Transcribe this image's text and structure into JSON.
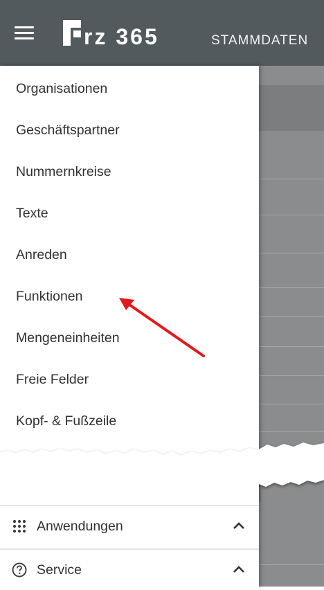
{
  "appbar": {
    "title": "STAMMDATEN",
    "logo_text": "rz 365",
    "menu_icon": "hamburger-menu-icon"
  },
  "drawer": {
    "items": [
      {
        "label": "Organisationen"
      },
      {
        "label": "Geschäftspartner"
      },
      {
        "label": "Nummernkreise"
      },
      {
        "label": "Texte"
      },
      {
        "label": "Anreden"
      },
      {
        "label": "Funktionen"
      },
      {
        "label": "Mengeneinheiten"
      },
      {
        "label": "Freie Felder"
      },
      {
        "label": "Kopf- & Fußzeile"
      }
    ],
    "sections": [
      {
        "label": "Anwendungen",
        "icon": "apps-grid-icon",
        "chevron": "chevron-up-icon"
      },
      {
        "label": "Service",
        "icon": "help-circle-icon",
        "chevron": "chevron-up-icon"
      }
    ]
  },
  "annotation": {
    "color": "#e11b1b",
    "icon": "red-arrow-icon",
    "target": "Funktionen"
  },
  "colors": {
    "appbar": "#525a5d",
    "drawer": "#ffffff",
    "text": "#2e3235",
    "backdrop": "#8b8c8d"
  }
}
